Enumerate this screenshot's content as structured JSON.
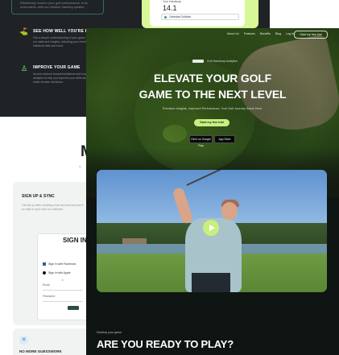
{
  "back_page": {
    "tile1_text": "Effortlessly monitor your golf performance, from scorecards, with our intuitive tracking system.",
    "features": [
      {
        "title": "SEE HOW WELL YOU'RE PLAYING",
        "desc": "Get a deeper understanding of your game with our stats and insights, including your trends, historical data and more."
      },
      {
        "title": "IMPROVE YOUR GAME",
        "desc": "Access tailored recommendations and expert analysis to help you improve your skills and make smarter decisions."
      }
    ],
    "handicap": {
      "label": "Your Handicap",
      "value": "14.1",
      "club": "Celestial Golfclub"
    },
    "section_big_letter": "M",
    "section_small_text": "Li",
    "sign_up": {
      "title": "SIGN UP & SYNC",
      "desc": "Get set up after creating a free account and you'll be able to sync with our software.",
      "form_title": "SIGN IN",
      "sso_facebook": "Sign in with Facebook",
      "sso_apple": "Sign in with Apple",
      "or_label": "or",
      "email_label": "Email",
      "password_label": "Password"
    },
    "guesswork_title": "NO MORE GUESSWORK"
  },
  "front_page": {
    "nav": [
      "About Us",
      "Features",
      "Benefits",
      "Blog",
      "Log in"
    ],
    "nav_cta": "Start my free trial",
    "brand_tag": "Golf Handicap Analytics",
    "hero_title_line1": "ELEVATE YOUR GOLF",
    "hero_title_line2": "GAME TO THE NEXT LEVEL",
    "hero_sub": "Precision Insights, Improved Performance, Your Golf Journey Starts Here.",
    "hero_cta": "Start my free trial",
    "store_google": "Get it on Google Play",
    "store_apple": "App Store",
    "ready_kicker": "Develop your game",
    "ready_title": "ARE YOU READY TO PLAY?"
  },
  "colors": {
    "accent": "#c7ef82",
    "dark": "#1f2326",
    "teal_border": "#2f6d63"
  }
}
